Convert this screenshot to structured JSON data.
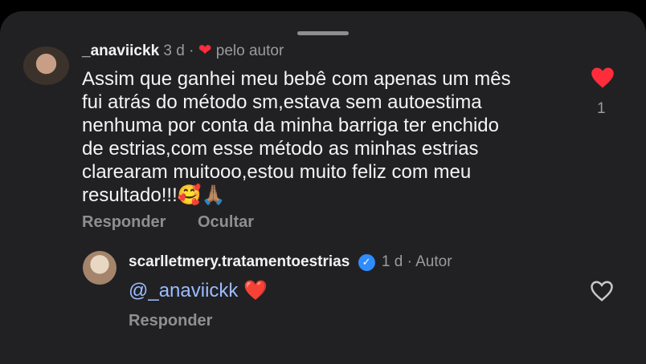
{
  "comment": {
    "username": "_anaviickk",
    "time": "3 d",
    "liked_by_author_label": "pelo autor",
    "text_lines": [
      "Assim que ganhei meu bebê com apenas um mês",
      "fui atrás do método sm,estava sem autoestima",
      "nenhuma por conta da minha barriga ter enchido",
      "de estrias,com esse método as minhas estrias",
      "clarearam muitooo,estou muito feliz com meu",
      "resultado!!!🥰🙏🏽"
    ],
    "like_count": "1",
    "reply_label": "Responder",
    "hide_label": "Ocultar"
  },
  "reply": {
    "username": "scarlletmery.tratamentoestrias",
    "time": "1 d",
    "role": "Autor",
    "text": "@_anaviickk",
    "emoji": "❤️",
    "reply_label": "Responder"
  },
  "colors": {
    "sheet": "#212123",
    "accent_red": "#ff2d3a",
    "mention": "#9bbcff",
    "verified": "#2f8cff"
  }
}
